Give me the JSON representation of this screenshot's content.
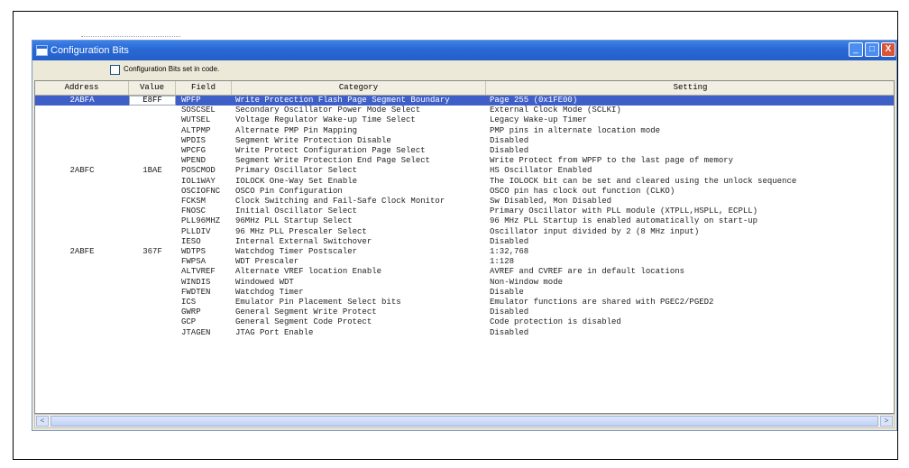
{
  "window": {
    "title": "Configuration Bits",
    "min_glyph": "_",
    "max_glyph": "□",
    "close_glyph": "X"
  },
  "options": {
    "checkbox_label": "Configuration Bits set in code."
  },
  "table": {
    "headers": [
      "Address",
      "Value",
      "Field",
      "Category",
      "Setting"
    ],
    "rows": [
      {
        "address": "2ABFA",
        "value": "E8FF",
        "field": "WPFP",
        "category": "Write Protection Flash Page Segment Boundary",
        "setting": "Page 255 (0x1FE00)"
      },
      {
        "address": "",
        "value": "",
        "field": "SOSCSEL",
        "category": "Secondary Oscillator Power Mode Select",
        "setting": "External Clock Mode (SCLKI)"
      },
      {
        "address": "",
        "value": "",
        "field": "WUTSEL",
        "category": "Voltage Regulator Wake-up Time Select",
        "setting": "Legacy Wake-up Timer"
      },
      {
        "address": "",
        "value": "",
        "field": "ALTPMP",
        "category": "Alternate PMP Pin Mapping",
        "setting": "PMP pins in alternate location mode"
      },
      {
        "address": "",
        "value": "",
        "field": "WPDIS",
        "category": "Segment Write Protection Disable",
        "setting": "Disabled"
      },
      {
        "address": "",
        "value": "",
        "field": "WPCFG",
        "category": "Write Protect Configuration Page Select",
        "setting": "Disabled"
      },
      {
        "address": "",
        "value": "",
        "field": "WPEND",
        "category": "Segment Write Protection End Page Select",
        "setting": "Write Protect from WPFP to the last page of memory"
      },
      {
        "address": "2ABFC",
        "value": "1BAE",
        "field": "POSCMOD",
        "category": "Primary Oscillator Select",
        "setting": "HS Oscillator Enabled"
      },
      {
        "address": "",
        "value": "",
        "field": "IOL1WAY",
        "category": "IOLOCK One-Way Set Enable",
        "setting": "The IOLOCK bit can be set and cleared using the unlock sequence"
      },
      {
        "address": "",
        "value": "",
        "field": "OSCIOFNC",
        "category": "OSCO Pin Configuration",
        "setting": "OSCO pin has clock out function (CLKO)"
      },
      {
        "address": "",
        "value": "",
        "field": "FCKSM",
        "category": "Clock Switching and Fail-Safe Clock Monitor",
        "setting": "Sw Disabled, Mon Disabled"
      },
      {
        "address": "",
        "value": "",
        "field": "FNOSC",
        "category": "Initial Oscillator Select",
        "setting": "Primary Oscillator with PLL module (XTPLL,HSPLL, ECPLL)"
      },
      {
        "address": "",
        "value": "",
        "field": "PLL96MHZ",
        "category": "96MHz PLL Startup Select",
        "setting": "96 MHz PLL Startup is enabled automatically on start-up"
      },
      {
        "address": "",
        "value": "",
        "field": "PLLDIV",
        "category": "96 MHz PLL Prescaler Select",
        "setting": "Oscillator input divided by 2 (8 MHz input)"
      },
      {
        "address": "",
        "value": "",
        "field": "IESO",
        "category": "Internal External Switchover",
        "setting": "Disabled"
      },
      {
        "address": "2ABFE",
        "value": "367F",
        "field": "WDTPS",
        "category": "Watchdog Timer Postscaler",
        "setting": "1:32,768"
      },
      {
        "address": "",
        "value": "",
        "field": "FWPSA",
        "category": "WDT Prescaler",
        "setting": "1:128"
      },
      {
        "address": "",
        "value": "",
        "field": "ALTVREF",
        "category": "Alternate VREF location Enable",
        "setting": "AVREF and CVREF are in default locations"
      },
      {
        "address": "",
        "value": "",
        "field": "WINDIS",
        "category": "Windowed WDT",
        "setting": "Non-Window mode"
      },
      {
        "address": "",
        "value": "",
        "field": "FWDTEN",
        "category": "Watchdog Timer",
        "setting": "Disable"
      },
      {
        "address": "",
        "value": "",
        "field": "ICS",
        "category": "Emulator Pin Placement Select bits",
        "setting": "Emulator functions are shared with PGEC2/PGED2"
      },
      {
        "address": "",
        "value": "",
        "field": "GWRP",
        "category": "General Segment Write Protect",
        "setting": "Disabled"
      },
      {
        "address": "",
        "value": "",
        "field": "GCP",
        "category": "General Segment Code Protect",
        "setting": "Code protection is disabled"
      },
      {
        "address": "",
        "value": "",
        "field": "JTAGEN",
        "category": "JTAG Port Enable",
        "setting": "Disabled"
      }
    ]
  },
  "scrollbar": {
    "left_glyph": "<",
    "right_glyph": ">"
  },
  "colors": {
    "titlebar": "#2a6ad6",
    "selection": "#3f5fc8"
  }
}
